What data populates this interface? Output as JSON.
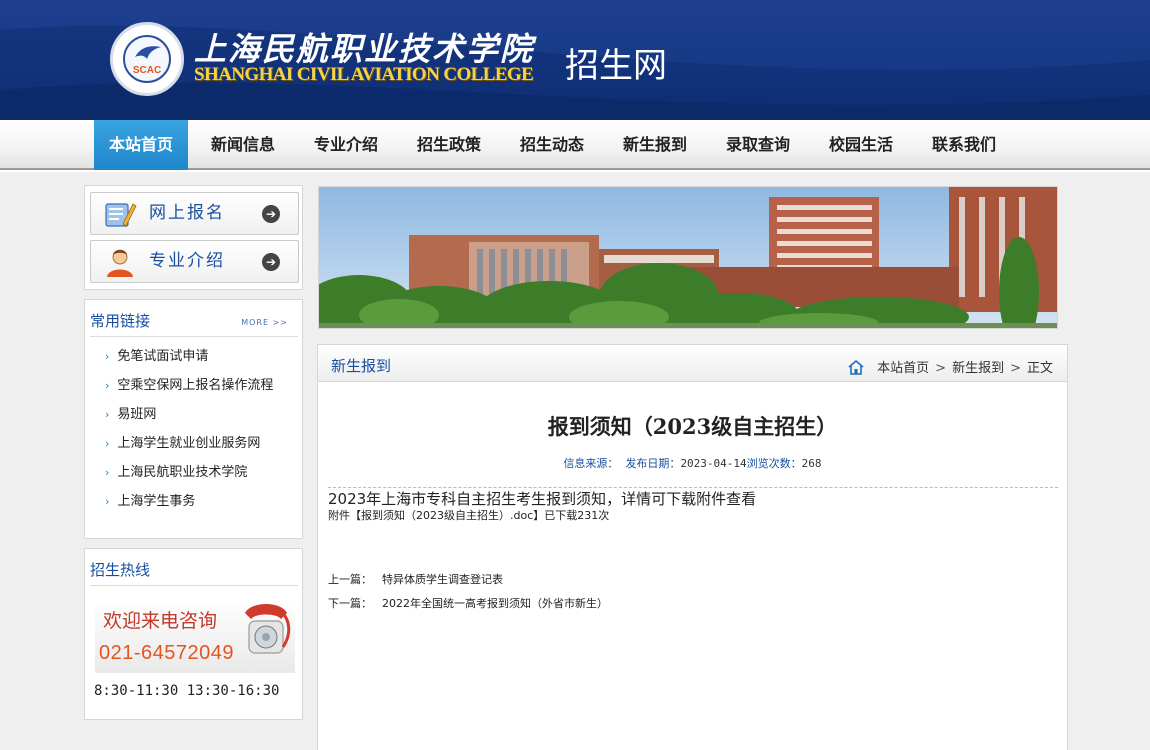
{
  "header": {
    "college_cn": "上海民航职业技术学院",
    "college_en": "SHANGHAI CIVIL AVIATION COLLEGE",
    "site_name": "招生网",
    "seal_text": "SCAC"
  },
  "nav": {
    "items": [
      "本站首页",
      "新闻信息",
      "专业介绍",
      "招生政策",
      "招生动态",
      "新生报到",
      "录取查询",
      "校园生活",
      "联系我们"
    ],
    "active": "本站首页"
  },
  "sidebar": {
    "buttons": [
      {
        "label": "网上报名",
        "icon": "form-pen-icon"
      },
      {
        "label": "专业介绍",
        "icon": "user-icon"
      }
    ],
    "links_panel": {
      "title": "常用链接",
      "more": "MORE >>",
      "items": [
        "免笔试面试申请",
        "空乘空保网上报名操作流程",
        "易班网",
        "上海学生就业创业服务网",
        "上海民航职业技术学院",
        "上海学生事务"
      ]
    },
    "hotline": {
      "title": "招生热线",
      "welcome": "欢迎来电咨询",
      "phone": "021-64572049",
      "hours": "8:30-11:30 13:30-16:30"
    }
  },
  "content": {
    "section_title": "新生报到",
    "breadcrumb": [
      "本站首页",
      "新生报到",
      "正文"
    ],
    "article": {
      "title": "报到须知（2023级自主招生）",
      "source_label": "信息来源：",
      "date_label": "发布日期：",
      "date": "2023-04-14",
      "views_label": "浏览次数：",
      "views": "268",
      "body": "2023年上海市专科自主招生考生报到须知，详情可下载附件查看",
      "attachment_prefix": "附件【",
      "attachment_name": "报到须知（2023级自主招生）.doc",
      "attachment_suffix": "】已下载231次",
      "prev_label": "上一篇：",
      "prev_title": "特异体质学生调查登记表",
      "next_label": "下一篇：",
      "next_title": "2022年全国统一高考报到须知（外省市新生）"
    }
  },
  "colors": {
    "header_blue": "#163a86",
    "nav_active": "#1e86cc",
    "link_blue": "#1a4fa0",
    "hotline_red": "#c0392b",
    "phone_orange": "#e2551f",
    "en_gold": "#f5d24a"
  }
}
